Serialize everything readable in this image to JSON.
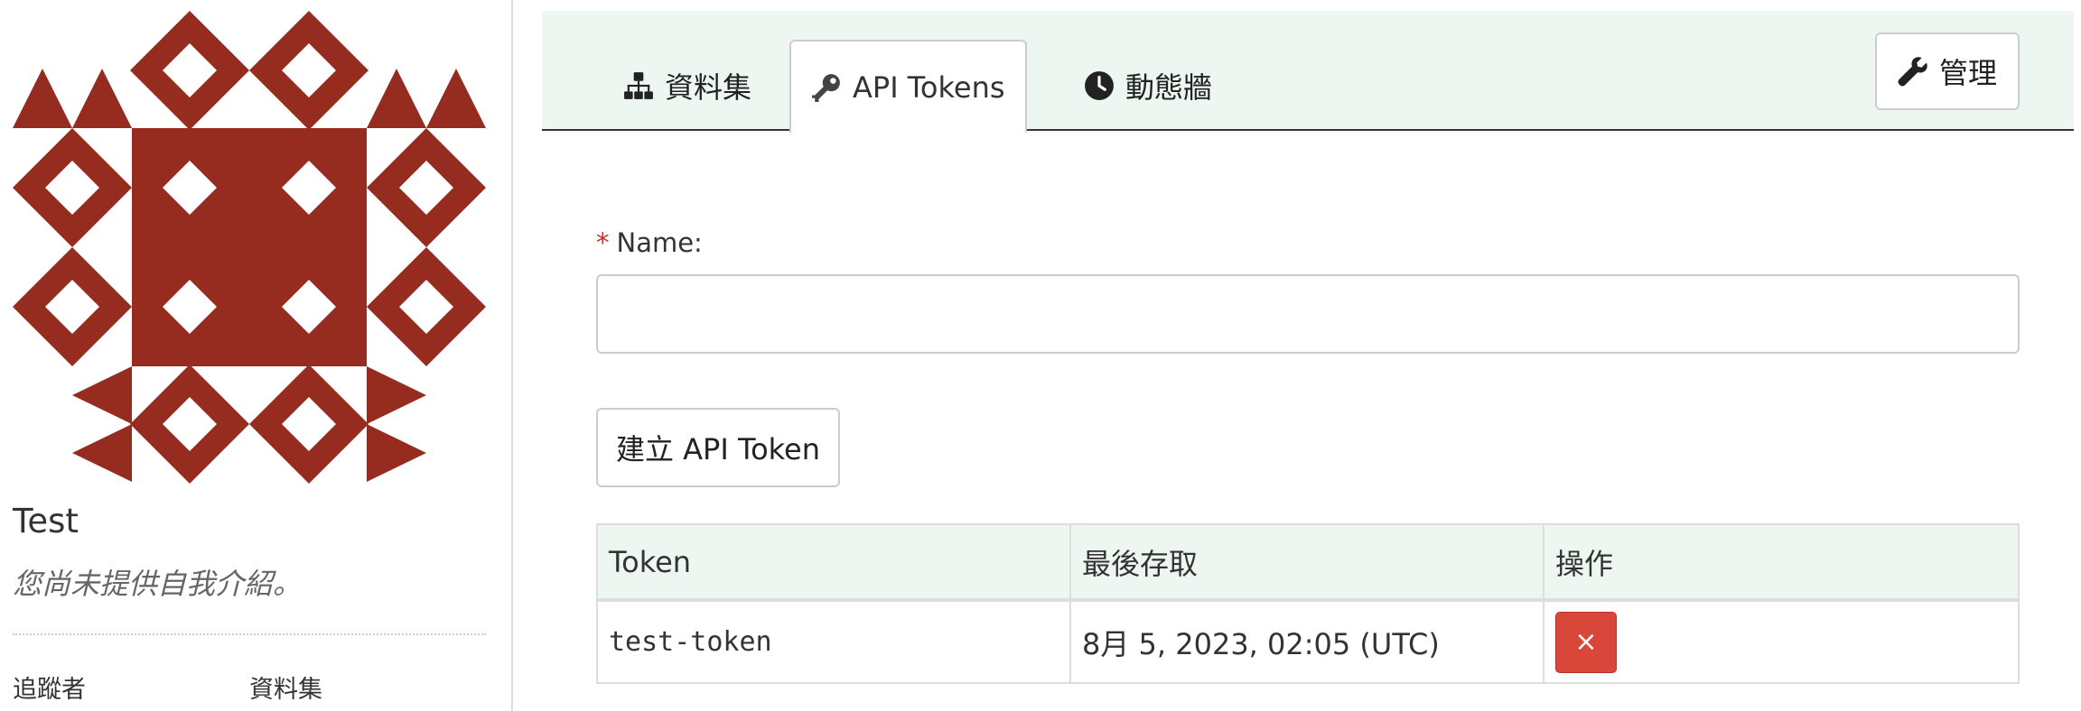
{
  "sidebar": {
    "username": "Test",
    "bio": "您尚未提供自我介紹。",
    "stats": {
      "followers_label": "追蹤者",
      "datasets_label": "資料集"
    },
    "avatar_color": "#952c1f"
  },
  "tabs": [
    {
      "label": "資料集",
      "icon": "sitemap-icon",
      "active": false
    },
    {
      "label": "API Tokens",
      "icon": "key-icon",
      "active": true
    },
    {
      "label": "動態牆",
      "icon": "clock-icon",
      "active": false
    }
  ],
  "manage_button": {
    "label": "管理",
    "icon": "wrench-icon"
  },
  "form": {
    "required_mark": "*",
    "name_label": "Name:",
    "name_value": "",
    "create_button": "建立 API Token"
  },
  "table": {
    "headers": [
      "Token",
      "最後存取",
      "操作"
    ],
    "rows": [
      {
        "token": "test-token",
        "last_access": "8月 5, 2023, 02:05 (UTC)",
        "delete_symbol": "×"
      }
    ]
  },
  "colors": {
    "accent_bg": "#edf6f1",
    "danger": "#d9473a"
  }
}
